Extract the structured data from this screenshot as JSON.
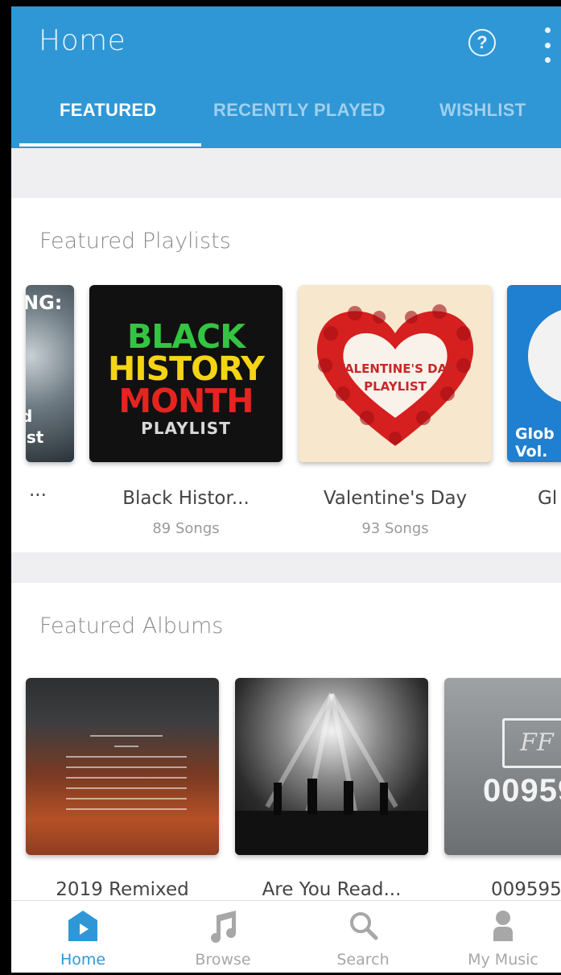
{
  "app_bar": {
    "title": "Home",
    "help_icon": "help-circle-icon",
    "more_icon": "more-vertical-icon",
    "background": "#2f97d5"
  },
  "tabs": [
    {
      "label": "FEATURED",
      "selected": true
    },
    {
      "label": "RECENTLY PLAYED",
      "selected": false
    },
    {
      "label": "WISHLIST",
      "selected": false
    }
  ],
  "featured_playlists": {
    "heading": "Featured Playlists",
    "items": [
      {
        "title": "...",
        "subtitle": "",
        "cover_text_top": "NG:",
        "cover_text_bottom": "d\nist"
      },
      {
        "title": "Black Histor...",
        "subtitle": "89 Songs",
        "cover_lines": [
          "BLACK",
          "HISTORY",
          "MONTH",
          "PLAYLIST"
        ]
      },
      {
        "title": "Valentine's Day",
        "subtitle": "93 Songs",
        "cover_lines": [
          "VALENTINE'S DAY",
          "PLAYLIST"
        ]
      },
      {
        "title": "Gl",
        "subtitle": "",
        "cover_lines": [
          "Glob",
          "Vol."
        ]
      }
    ]
  },
  "featured_albums": {
    "heading": "Featured Albums",
    "items": [
      {
        "title": "2019 Remixed"
      },
      {
        "title": "Are You Read..."
      },
      {
        "title": "009595",
        "cover_text": "00959",
        "cover_monogram": "FF"
      }
    ]
  },
  "bottom_nav": [
    {
      "label": "Home",
      "icon": "home-play-icon",
      "active": true
    },
    {
      "label": "Browse",
      "icon": "music-note-icon",
      "active": false
    },
    {
      "label": "Search",
      "icon": "search-icon",
      "active": false
    },
    {
      "label": "My Music",
      "icon": "person-icon",
      "active": false
    }
  ],
  "colors": {
    "accent": "#2f97d5",
    "inactive": "#a7a7a7"
  }
}
